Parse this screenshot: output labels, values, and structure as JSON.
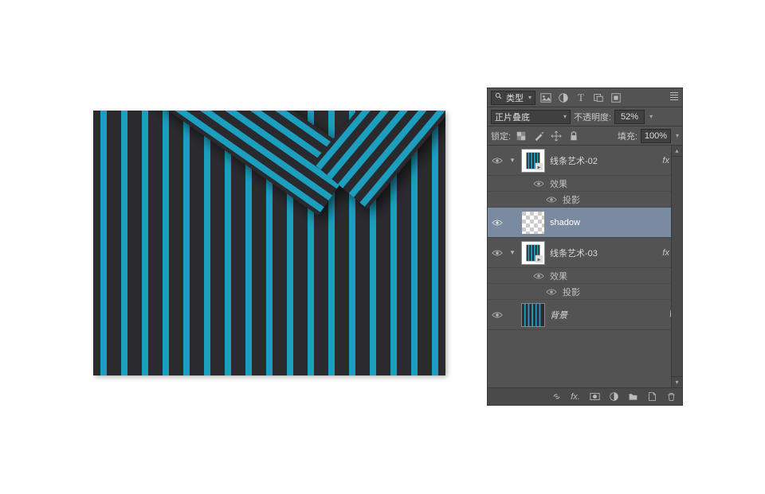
{
  "filter": {
    "search_icon": "search-icon",
    "type_label": "类型",
    "image_filter": "image-filter-icon",
    "adjust_filter": "adjustment-filter-icon",
    "text_filter": "text-filter-icon",
    "shape_filter": "shape-filter-icon",
    "smart_filter": "smart-object-filter-icon"
  },
  "blend": {
    "mode": "正片叠底",
    "opacity_label": "不透明度:",
    "opacity_value": "52%"
  },
  "lock": {
    "label": "锁定:",
    "fill_label": "填充:",
    "fill_value": "100%"
  },
  "layers": [
    {
      "name": "线条艺术-02",
      "fx": "fx",
      "effects_label": "效果",
      "drop_shadow_label": "投影"
    },
    {
      "name": "shadow",
      "selected": true
    },
    {
      "name": "线条艺术-03",
      "fx": "fx",
      "effects_label": "效果",
      "drop_shadow_label": "投影"
    },
    {
      "name": "背景",
      "locked": true
    }
  ],
  "footer": {
    "link": "link-icon",
    "fx": "fx.",
    "mask": "mask-icon",
    "adjust": "adjustment-icon",
    "group": "group-icon",
    "new": "new-layer-icon",
    "trash": "trash-icon"
  }
}
